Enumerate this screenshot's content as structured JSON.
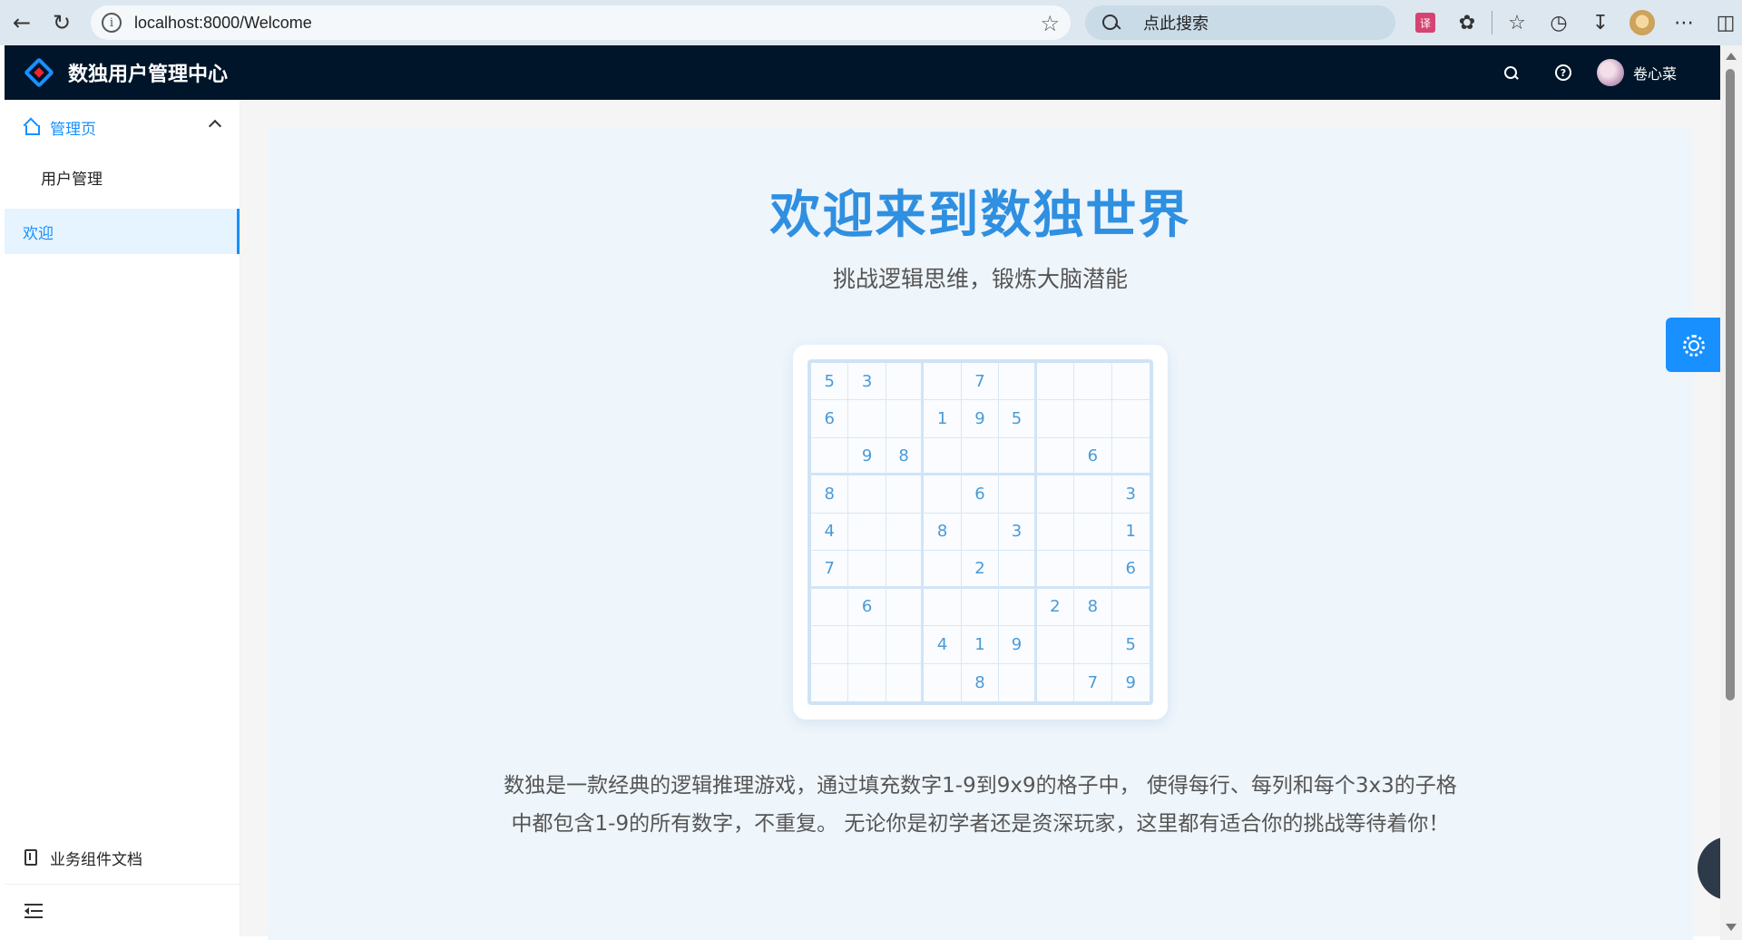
{
  "browser": {
    "url": "localhost:8000/Welcome",
    "search_placeholder": "点此搜索",
    "translate_label": "译"
  },
  "header": {
    "title": "数独用户管理中心",
    "help_glyph": "?",
    "user_name": "卷心菜"
  },
  "sidebar": {
    "group_label": "管理页",
    "child_label": "用户管理",
    "active_label": "欢迎",
    "doc_label": "业务组件文档"
  },
  "main": {
    "title": "欢迎来到数独世界",
    "subtitle": "挑战逻辑思维，锻炼大脑潜能",
    "description": "数独是一款经典的逻辑推理游戏，通过填充数字1-9到9x9的格子中， 使得每行、每列和每个3x3的子格中都包含1-9的所有数字，不重复。 无论你是初学者还是资深玩家，这里都有适合你的挑战等待着你！",
    "sudoku": [
      [
        "5",
        "3",
        "",
        "",
        "7",
        "",
        "",
        "",
        ""
      ],
      [
        "6",
        "",
        "",
        "1",
        "9",
        "5",
        "",
        "",
        ""
      ],
      [
        "",
        "9",
        "8",
        "",
        "",
        "",
        "",
        "6",
        ""
      ],
      [
        "8",
        "",
        "",
        "",
        "6",
        "",
        "",
        "",
        "3"
      ],
      [
        "4",
        "",
        "",
        "8",
        "",
        "3",
        "",
        "",
        "1"
      ],
      [
        "7",
        "",
        "",
        "",
        "2",
        "",
        "",
        "",
        "6"
      ],
      [
        "",
        "6",
        "",
        "",
        "",
        "",
        "2",
        "8",
        ""
      ],
      [
        "",
        "",
        "",
        "4",
        "1",
        "9",
        "",
        "",
        "5"
      ],
      [
        "",
        "",
        "",
        "",
        "8",
        "",
        "",
        "7",
        "9"
      ]
    ]
  },
  "colors": {
    "accent": "#1890ff",
    "header_bg": "#001529",
    "title_blue": "#2f8fe0"
  }
}
